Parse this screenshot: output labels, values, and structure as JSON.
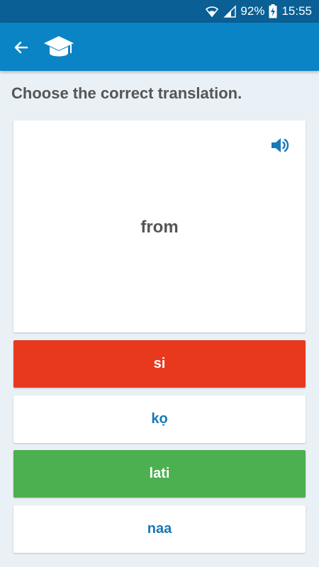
{
  "status_bar": {
    "battery": "92%",
    "time": "15:55",
    "icons": [
      "wifi-icon",
      "signal-icon",
      "battery-charging-icon"
    ]
  },
  "app_bar": {
    "back_icon": "arrow-left-icon",
    "logo_icon": "graduation-cap-icon"
  },
  "quiz": {
    "prompt": "Choose the correct translation.",
    "word": "from",
    "speaker_icon": "speaker-icon",
    "answers": [
      {
        "label": "si",
        "state": "wrong"
      },
      {
        "label": "kọ",
        "state": "neutral"
      },
      {
        "label": "lati",
        "state": "correct"
      },
      {
        "label": "naa",
        "state": "neutral"
      }
    ]
  },
  "colors": {
    "status_bar": "#0a5f95",
    "app_bar": "#0b84c6",
    "background": "#e9f1f7",
    "wrong": "#e8391f",
    "correct": "#4caf50",
    "answer_text": "#1679b8",
    "prompt_text": "#555555"
  }
}
